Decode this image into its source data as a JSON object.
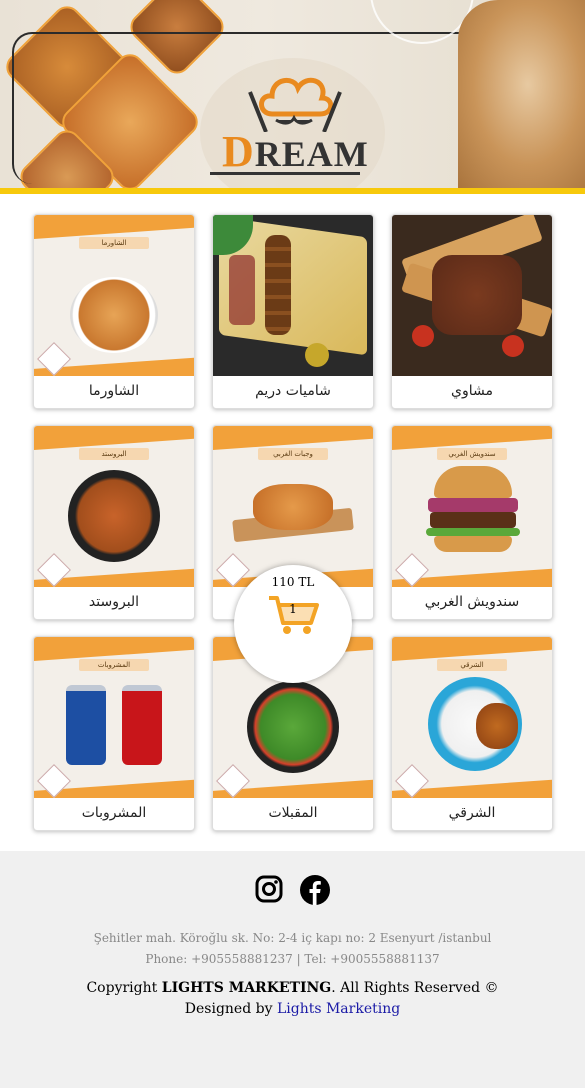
{
  "header": {
    "logo_text": "DREAM",
    "brand_color": "#e98a1f",
    "bar_color": "#f7c90c"
  },
  "categories": [
    {
      "label": "مشاوي",
      "poster_title": ""
    },
    {
      "label": "شاميات دريم",
      "poster_title": ""
    },
    {
      "label": "الشاورما",
      "poster_title": "الشاورما"
    },
    {
      "label": "سندويش الغربي",
      "poster_title": "سندويش الغربي"
    },
    {
      "label": "",
      "poster_title": "وجبات الغربي"
    },
    {
      "label": "البروستد",
      "poster_title": "البروستد"
    },
    {
      "label": "الشرقي",
      "poster_title": "الشرقي"
    },
    {
      "label": "المقبلات",
      "poster_title": ""
    },
    {
      "label": "المشروبات",
      "poster_title": "المشروبات"
    }
  ],
  "cart": {
    "total": "110 TL",
    "count": "1",
    "icon": "shopping-cart-icon",
    "color": "#f3a425"
  },
  "footer": {
    "social": [
      "instagram-icon",
      "facebook-icon"
    ],
    "address": "Şehitler mah. Köroğlu sk. No: 2-4 iç kapı no: 2 Esenyurt /istanbul",
    "phones": "Phone: +905558881237 | Tel: +9005558881137",
    "copyright_prefix": "Copyright ",
    "copyright_brand": "LIGHTS MARKETING",
    "copyright_suffix": ". All Rights Reserved ©",
    "designed_prefix": "Designed by ",
    "designed_link": "Lights Marketing"
  }
}
